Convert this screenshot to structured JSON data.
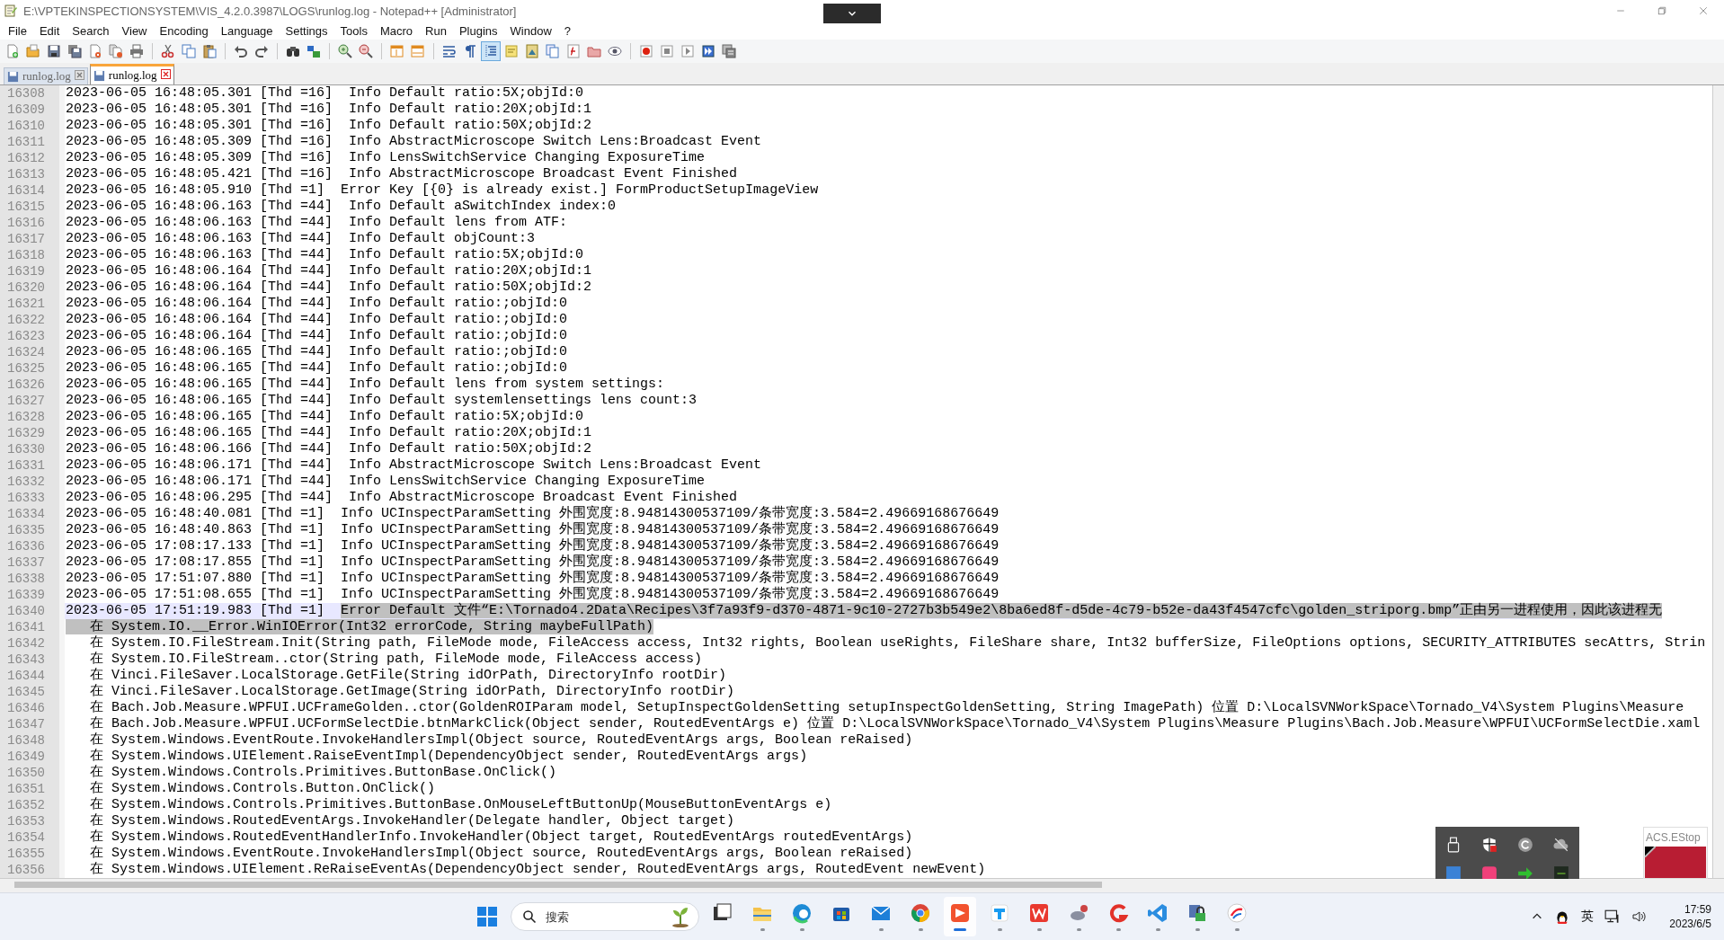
{
  "window": {
    "title": "E:\\VPTEKINSPECTIONSYSTEM\\VIS_4.2.0.3987\\LOGS\\runlog.log - Notepad++ [Administrator]"
  },
  "menu": [
    "File",
    "Edit",
    "Search",
    "View",
    "Encoding",
    "Language",
    "Settings",
    "Tools",
    "Macro",
    "Run",
    "Plugins",
    "Window",
    "?"
  ],
  "toolbar": [
    {
      "kind": "new",
      "on": false
    },
    {
      "kind": "open",
      "on": false
    },
    {
      "kind": "save",
      "on": false
    },
    {
      "kind": "save-all",
      "on": false
    },
    {
      "kind": "close",
      "on": false
    },
    {
      "kind": "close-all",
      "on": false
    },
    {
      "kind": "print",
      "on": false
    },
    {
      "kind": "cut",
      "on": false
    },
    {
      "kind": "copy",
      "on": false
    },
    {
      "kind": "paste",
      "on": false
    },
    {
      "kind": "undo",
      "on": false
    },
    {
      "kind": "redo",
      "on": false
    },
    {
      "kind": "find",
      "on": false
    },
    {
      "kind": "replace",
      "on": false
    },
    {
      "kind": "zoom-in",
      "on": false
    },
    {
      "kind": "zoom-out",
      "on": false
    },
    {
      "kind": "sync-v",
      "on": false
    },
    {
      "kind": "sync-h",
      "on": false
    },
    {
      "kind": "wrap",
      "on": false
    },
    {
      "kind": "pilcrow",
      "on": false
    },
    {
      "kind": "indent-guide",
      "on": true
    },
    {
      "kind": "note",
      "on": false
    },
    {
      "kind": "map",
      "on": false
    },
    {
      "kind": "list",
      "on": false
    },
    {
      "kind": "function",
      "on": false
    },
    {
      "kind": "folder",
      "on": false
    },
    {
      "kind": "eye",
      "on": false
    },
    {
      "kind": "record",
      "on": false
    },
    {
      "kind": "stop",
      "on": false
    },
    {
      "kind": "play",
      "on": false
    },
    {
      "kind": "play-multi",
      "on": false
    },
    {
      "kind": "save-macro",
      "on": false
    }
  ],
  "tabs": [
    {
      "label": "runlog.log",
      "selected": false
    },
    {
      "label": "runlog.log",
      "selected": true
    }
  ],
  "lines": [
    {
      "number": "16308",
      "text": "2023-06-05 16:48:05.301 [Thd =16]  Info Default ratio:5X;objId:0"
    },
    {
      "number": "16309",
      "text": "2023-06-05 16:48:05.301 [Thd =16]  Info Default ratio:20X;objId:1"
    },
    {
      "number": "16310",
      "text": "2023-06-05 16:48:05.301 [Thd =16]  Info Default ratio:50X;objId:2"
    },
    {
      "number": "16311",
      "text": "2023-06-05 16:48:05.309 [Thd =16]  Info AbstractMicroscope Switch Lens:Broadcast Event"
    },
    {
      "number": "16312",
      "text": "2023-06-05 16:48:05.309 [Thd =16]  Info LensSwitchService Changing ExposureTime"
    },
    {
      "number": "16313",
      "text": "2023-06-05 16:48:05.421 [Thd =16]  Info AbstractMicroscope Broadcast Event Finished"
    },
    {
      "number": "16314",
      "text": "2023-06-05 16:48:05.910 [Thd =1]  Error Key [{0} is already exist.] FormProductSetupImageView"
    },
    {
      "number": "16315",
      "text": "2023-06-05 16:48:06.163 [Thd =44]  Info Default aSwitchIndex index:0"
    },
    {
      "number": "16316",
      "text": "2023-06-05 16:48:06.163 [Thd =44]  Info Default lens from ATF:"
    },
    {
      "number": "16317",
      "text": "2023-06-05 16:48:06.163 [Thd =44]  Info Default objCount:3"
    },
    {
      "number": "16318",
      "text": "2023-06-05 16:48:06.163 [Thd =44]  Info Default ratio:5X;objId:0"
    },
    {
      "number": "16319",
      "text": "2023-06-05 16:48:06.164 [Thd =44]  Info Default ratio:20X;objId:1"
    },
    {
      "number": "16320",
      "text": "2023-06-05 16:48:06.164 [Thd =44]  Info Default ratio:50X;objId:2"
    },
    {
      "number": "16321",
      "text": "2023-06-05 16:48:06.164 [Thd =44]  Info Default ratio:;objId:0"
    },
    {
      "number": "16322",
      "text": "2023-06-05 16:48:06.164 [Thd =44]  Info Default ratio:;objId:0"
    },
    {
      "number": "16323",
      "text": "2023-06-05 16:48:06.164 [Thd =44]  Info Default ratio:;objId:0"
    },
    {
      "number": "16324",
      "text": "2023-06-05 16:48:06.165 [Thd =44]  Info Default ratio:;objId:0"
    },
    {
      "number": "16325",
      "text": "2023-06-05 16:48:06.165 [Thd =44]  Info Default ratio:;objId:0"
    },
    {
      "number": "16326",
      "text": "2023-06-05 16:48:06.165 [Thd =44]  Info Default lens from system settings:"
    },
    {
      "number": "16327",
      "text": "2023-06-05 16:48:06.165 [Thd =44]  Info Default systemlensettings lens count:3"
    },
    {
      "number": "16328",
      "text": "2023-06-05 16:48:06.165 [Thd =44]  Info Default ratio:5X;objId:0"
    },
    {
      "number": "16329",
      "text": "2023-06-05 16:48:06.165 [Thd =44]  Info Default ratio:20X;objId:1"
    },
    {
      "number": "16330",
      "text": "2023-06-05 16:48:06.166 [Thd =44]  Info Default ratio:50X;objId:2"
    },
    {
      "number": "16331",
      "text": "2023-06-05 16:48:06.171 [Thd =44]  Info AbstractMicroscope Switch Lens:Broadcast Event"
    },
    {
      "number": "16332",
      "text": "2023-06-05 16:48:06.171 [Thd =44]  Info LensSwitchService Changing ExposureTime"
    },
    {
      "number": "16333",
      "text": "2023-06-05 16:48:06.295 [Thd =44]  Info AbstractMicroscope Broadcast Event Finished"
    },
    {
      "number": "16334",
      "text": "2023-06-05 16:48:40.081 [Thd =1]  Info UCInspectParamSetting 外围宽度:8.94814300537109/条带宽度:3.584=2.49669168676649"
    },
    {
      "number": "16335",
      "text": "2023-06-05 16:48:40.863 [Thd =1]  Info UCInspectParamSetting 外围宽度:8.94814300537109/条带宽度:3.584=2.49669168676649"
    },
    {
      "number": "16336",
      "text": "2023-06-05 17:08:17.133 [Thd =1]  Info UCInspectParamSetting 外围宽度:8.94814300537109/条带宽度:3.584=2.49669168676649"
    },
    {
      "number": "16337",
      "text": "2023-06-05 17:08:17.855 [Thd =1]  Info UCInspectParamSetting 外围宽度:8.94814300537109/条带宽度:3.584=2.49669168676649"
    },
    {
      "number": "16338",
      "text": "2023-06-05 17:51:07.880 [Thd =1]  Info UCInspectParamSetting 外围宽度:8.94814300537109/条带宽度:3.584=2.49669168676649"
    },
    {
      "number": "16339",
      "text": "2023-06-05 17:51:08.655 [Thd =1]  Info UCInspectParamSetting 外围宽度:8.94814300537109/条带宽度:3.584=2.49669168676649"
    },
    {
      "number": "16340",
      "current": true,
      "text": "2023-06-05 17:51:19.983 [Thd =1]  ",
      "selection": "Error Default 文件“E:\\Tornado4.2Data\\Recipes\\3f7a93f9-d370-4871-9c10-2727b3b549e2\\8ba6ed8f-d5de-4c79-b52e-da43f4547cfc\\golden_striporg.bmp”正由另一进程使用，因此该进程无"
    },
    {
      "number": "16341",
      "kind": "stack",
      "selection": "在 System.IO.__Error.WinIOError(Int32 errorCode, String maybeFullPath)"
    },
    {
      "number": "16342",
      "kind": "stack",
      "text": "在 System.IO.FileStream.Init(String path, FileMode mode, FileAccess access, Int32 rights, Boolean useRights, FileShare share, Int32 bufferSize, FileOptions options, SECURITY_ATTRIBUTES secAttrs, Strin"
    },
    {
      "number": "16343",
      "kind": "stack",
      "text": "在 System.IO.FileStream..ctor(String path, FileMode mode, FileAccess access)"
    },
    {
      "number": "16344",
      "kind": "stack",
      "text": "在 Vinci.FileSaver.LocalStorage.GetFile(String idOrPath, DirectoryInfo rootDir)"
    },
    {
      "number": "16345",
      "kind": "stack",
      "text": "在 Vinci.FileSaver.LocalStorage.GetImage(String idOrPath, DirectoryInfo rootDir)"
    },
    {
      "number": "16346",
      "kind": "stack",
      "text": "在 Bach.Job.Measure.WPFUI.UCFrameGolden..ctor(GoldenROIParam model, SetupInspectGoldenSetting setupInspectGoldenSetting, String ImagePath) 位置 D:\\LocalSVNWorkSpace\\Tornado_V4\\System Plugins\\Measure"
    },
    {
      "number": "16347",
      "kind": "stack",
      "text": "在 Bach.Job.Measure.WPFUI.UCFormSelectDie.btnMarkClick(Object sender, RoutedEventArgs e) 位置 D:\\LocalSVNWorkSpace\\Tornado_V4\\System Plugins\\Measure Plugins\\Bach.Job.Measure\\WPFUI\\UCFormSelectDie.xaml"
    },
    {
      "number": "16348",
      "kind": "stack",
      "text": "在 System.Windows.EventRoute.InvokeHandlersImpl(Object source, RoutedEventArgs args, Boolean reRaised)"
    },
    {
      "number": "16349",
      "kind": "stack",
      "text": "在 System.Windows.UIElement.RaiseEventImpl(DependencyObject sender, RoutedEventArgs args)"
    },
    {
      "number": "16350",
      "kind": "stack",
      "text": "在 System.Windows.Controls.Primitives.ButtonBase.OnClick()"
    },
    {
      "number": "16351",
      "kind": "stack",
      "text": "在 System.Windows.Controls.Button.OnClick()"
    },
    {
      "number": "16352",
      "kind": "stack",
      "text": "在 System.Windows.Controls.Primitives.ButtonBase.OnMouseLeftButtonUp(MouseButtonEventArgs e)"
    },
    {
      "number": "16353",
      "kind": "stack",
      "text": "在 System.Windows.RoutedEventArgs.InvokeHandler(Delegate handler, Object target)"
    },
    {
      "number": "16354",
      "kind": "stack",
      "text": "在 System.Windows.RoutedEventHandlerInfo.InvokeHandler(Object target, RoutedEventArgs routedEventArgs)"
    },
    {
      "number": "16355",
      "kind": "stack",
      "text": "在 System.Windows.EventRoute.InvokeHandlersImpl(Object source, RoutedEventArgs args, Boolean reRaised)"
    },
    {
      "number": "16356",
      "kind": "stack",
      "text": "在 System.Windows.UIElement.ReRaiseEventAs(DependencyObject sender, RoutedEventArgs args, RoutedEvent newEvent)"
    }
  ],
  "estop_window": {
    "title": "ACS.EStop"
  },
  "taskbar": {
    "search": {
      "placeholder": "搜索"
    },
    "apps": [
      {
        "kind": "task-view",
        "running": false,
        "selected": false
      },
      {
        "kind": "folder",
        "running": true,
        "selected": false
      },
      {
        "kind": "edge",
        "running": true,
        "selected": false
      },
      {
        "kind": "store",
        "running": false,
        "selected": false
      },
      {
        "kind": "mail",
        "running": true,
        "selected": false
      },
      {
        "kind": "chrome",
        "running": true,
        "selected": false
      },
      {
        "kind": "player",
        "running": true,
        "selected": true
      },
      {
        "kind": "pin",
        "running": true,
        "selected": false
      },
      {
        "kind": "office",
        "running": true,
        "selected": false
      },
      {
        "kind": "game",
        "running": true,
        "selected": false
      },
      {
        "kind": "swirl",
        "running": true,
        "selected": false
      },
      {
        "kind": "code",
        "running": true,
        "selected": false
      },
      {
        "kind": "lock",
        "running": true,
        "selected": false
      },
      {
        "kind": "circle",
        "running": true,
        "selected": false
      }
    ],
    "input_mode": "英",
    "time": "17:59",
    "date": "2023/6/5"
  }
}
